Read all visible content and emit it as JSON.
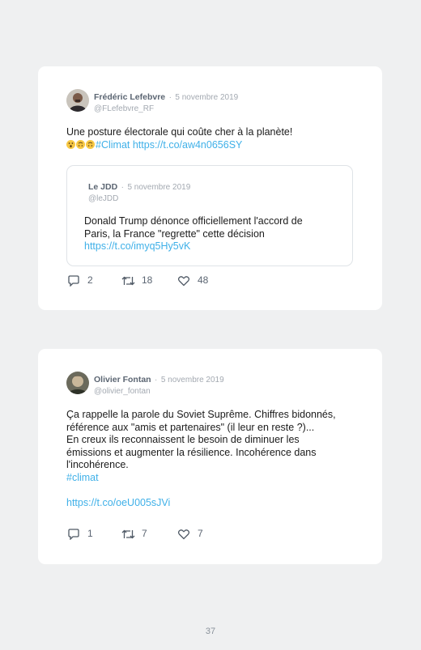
{
  "tweets": [
    {
      "author": "Frédéric Lefebvre",
      "separator": "·",
      "date": "5 novembre 2019",
      "handle": "@FLefebvre_RF",
      "text_line1": "Une posture électorale qui coûte cher à la planète!",
      "hashtag": "#Climat",
      "link": "https://t.co/aw4n0656SY",
      "emoji_icons": [
        "astonished-face-icon",
        "upside-down-face-icon",
        "upside-down-face-icon"
      ],
      "quote": {
        "author": "Le JDD",
        "separator": "·",
        "date": "5 novembre 2019",
        "handle": "@leJDD",
        "lines": [
          "Donald Trump dénonce officiellement l'accord de",
          "Paris, la France \"regrette\" cette décision"
        ],
        "link": "https://t.co/imyq5Hy5vK"
      },
      "replies": "2",
      "retweets": "18",
      "likes": "48"
    },
    {
      "author": "Olivier Fontan",
      "separator": "·",
      "date": "5 novembre 2019",
      "handle": "@olivier_fontan",
      "lines": [
        "Ça rappelle la parole du Soviet Suprême. Chiffres bidonnés,",
        "référence aux \"amis et partenaires\" (il leur en reste ?)...",
        "En creux ils reconnaissent le besoin de diminuer les",
        "émissions et augmenter la résilience. Incohérence dans",
        "l'incohérence."
      ],
      "hashtag": "#climat",
      "link": "https://t.co/oeU005sJVi",
      "replies": "1",
      "retweets": "7",
      "likes": "7"
    }
  ],
  "page_number": "37",
  "colors": {
    "background": "#eff0f1",
    "card": "#ffffff",
    "link": "#3fb0e8",
    "muted": "#a3a9b1"
  }
}
